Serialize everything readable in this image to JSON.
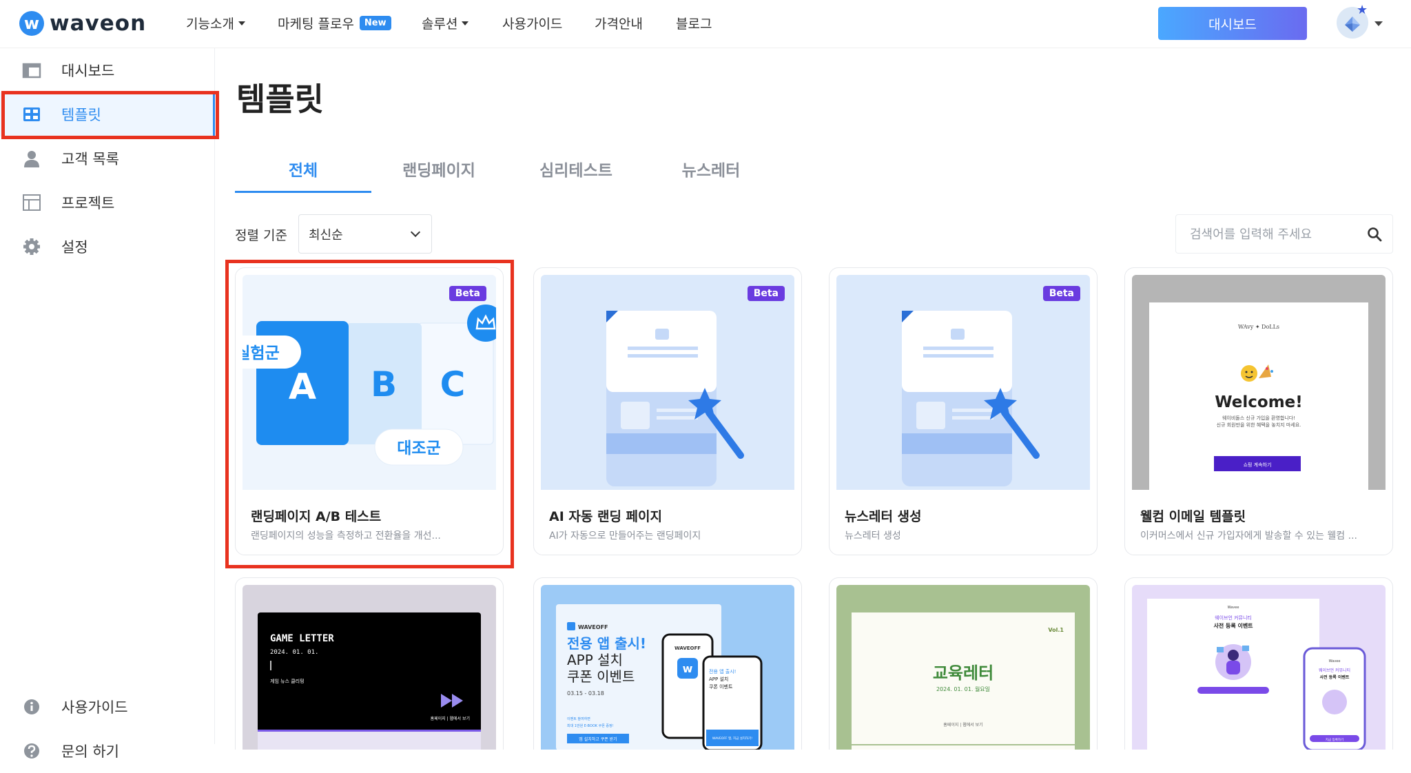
{
  "brand": {
    "logo_mark": "w",
    "logo_text": "waveon"
  },
  "nav": {
    "items": [
      {
        "label": "기능소개",
        "dropdown": true
      },
      {
        "label": "마케팅 플로우",
        "badge": "New"
      },
      {
        "label": "솔루션",
        "dropdown": true
      },
      {
        "label": "사용가이드"
      },
      {
        "label": "가격안내"
      },
      {
        "label": "블로그"
      }
    ],
    "dashboard_button": "대시보드"
  },
  "sidebar": {
    "items": [
      {
        "label": "대시보드",
        "icon": "window-icon"
      },
      {
        "label": "템플릿",
        "icon": "grid-icon",
        "active": true
      },
      {
        "label": "고객 목록",
        "icon": "person-icon"
      },
      {
        "label": "프로젝트",
        "icon": "layout-icon"
      },
      {
        "label": "설정",
        "icon": "gear-icon"
      }
    ],
    "bottom": [
      {
        "label": "사용가이드",
        "icon": "info-icon"
      },
      {
        "label": "문의 하기",
        "icon": "question-icon"
      }
    ]
  },
  "page": {
    "title": "템플릿"
  },
  "tabs": [
    {
      "label": "전체",
      "active": true
    },
    {
      "label": "랜딩페이지"
    },
    {
      "label": "심리테스트"
    },
    {
      "label": "뉴스레터"
    }
  ],
  "sort": {
    "label": "정렬 기준",
    "value": "최신순"
  },
  "search": {
    "placeholder": "검색어를 입력해 주세요"
  },
  "cards": [
    {
      "title": "랜딩페이지 A/B 테스트",
      "desc": "랜딩페이지의 성능을 측정하고 전환율을 개선...",
      "badge": "Beta",
      "thumb": {
        "letters": [
          "A",
          "B",
          "C"
        ],
        "pill_top": "실험군",
        "pill_bottom": "대조군"
      }
    },
    {
      "title": "AI 자동 랜딩 페이지",
      "desc": "AI가 자동으로 만들어주는 랜딩페이지",
      "badge": "Beta"
    },
    {
      "title": "뉴스레터 생성",
      "desc": "뉴스레터 생성",
      "badge": "Beta"
    },
    {
      "title": "웰컴 이메일 템플릿",
      "desc": "이커머스에서 신규 가입자에게 발송할 수 있는 웰컴 ...",
      "thumb": {
        "brand": "WAvy ✦ DoLLs",
        "heading": "Welcome!",
        "line1": "웨이비돌스 신규 가입을 환영합니다!",
        "line2": "신규 회원만을 위한 혜택을 놓치지 마세요.",
        "button": "쇼핑 계속하기"
      }
    }
  ],
  "cards_row2": [
    {
      "thumb": {
        "title": "GAME LETTER",
        "date": "2024. 01. 01.",
        "sub": "게임 뉴스 클리핑",
        "foot": "홈페이지 | 웹에서 보기"
      }
    },
    {
      "thumb": {
        "brand": "WAVEOFF",
        "line1": "전용 앱 출시!",
        "line2": "APP 설치",
        "line3": "쿠폰 이벤트",
        "date": "03.15 - 03.18",
        "note": "이벤트 참여하면",
        "note2": "최대 1만원 E-BOOK 쿠폰 증정!",
        "btn": "앱 설치하고 쿠폰 받기",
        "phone_brand": "WAVEOFF",
        "phone2_l1": "전용 앱 출시!",
        "phone2_l2": "APP 설치",
        "phone2_l3": "쿠폰 이벤트",
        "phone2_btn": "WAVEOFF 앱, 지금 설치하기!"
      }
    },
    {
      "thumb": {
        "vol": "Vol.1",
        "title": "교육레터",
        "date": "2024. 01. 01. 월요일",
        "foot": "홈페이지 | 웹에서 보기"
      }
    },
    {
      "thumb": {
        "brand": "Wavee",
        "line1": "웨이브언 커뮤니티",
        "line2": "사전 등록 이벤트",
        "phone_brand": "Wavee",
        "phone_l1": "웨이브언 커뮤니티",
        "phone_l2": "사전 등록 이벤트",
        "btn": "지금 등록하기"
      }
    }
  ],
  "colors": {
    "accent": "#2e8cf0",
    "highlight": "#e8321f",
    "beta": "#6a3be0"
  }
}
